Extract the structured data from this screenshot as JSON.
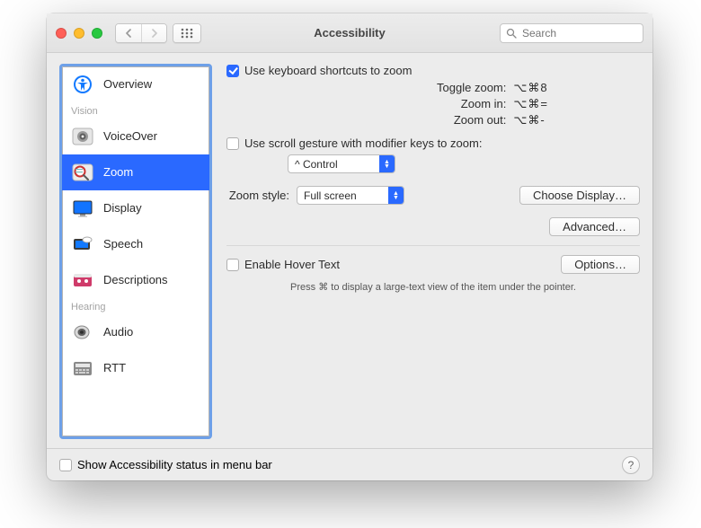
{
  "window_title": "Accessibility",
  "search_placeholder": "Search",
  "sidebar": {
    "overview": "Overview",
    "group_vision": "Vision",
    "voiceover": "VoiceOver",
    "zoom": "Zoom",
    "display": "Display",
    "speech": "Speech",
    "descriptions": "Descriptions",
    "group_hearing": "Hearing",
    "audio": "Audio",
    "rtt": "RTT"
  },
  "main": {
    "use_kb_shortcuts": "Use keyboard shortcuts to zoom",
    "shortcuts": {
      "toggle_label": "Toggle zoom:",
      "toggle_key": "⌥⌘8",
      "in_label": "Zoom in:",
      "in_key": "⌥⌘=",
      "out_label": "Zoom out:",
      "out_key": "⌥⌘-"
    },
    "scroll_gesture": "Use scroll gesture with modifier keys to zoom:",
    "modifier_value": "^ Control",
    "zoom_style_label": "Zoom style:",
    "zoom_style_value": "Full screen",
    "choose_display": "Choose Display…",
    "advanced": "Advanced…",
    "hover_text": "Enable Hover Text",
    "options": "Options…",
    "hover_hint": "Press ⌘ to display a large-text view of the item under the pointer."
  },
  "footer": {
    "status_menu": "Show Accessibility status in menu bar"
  }
}
